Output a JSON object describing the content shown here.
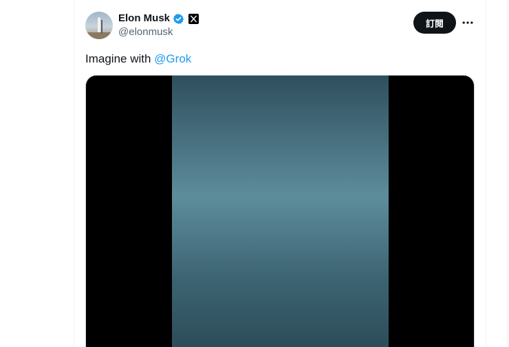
{
  "tweet": {
    "author": {
      "display_name": "Elon Musk",
      "handle": "@elonmusk",
      "verified": true,
      "avatar_icon": "rocket-launch-avatar"
    },
    "subscribe_label": "訂閱",
    "more_icon": "ellipsis-icon",
    "text": {
      "prefix": "Imagine with ",
      "mention": "@Grok"
    },
    "media": {
      "type": "image",
      "alt": "AI-generated image"
    }
  },
  "colors": {
    "link": "#1d9bf0",
    "verified": "#1d9bf0",
    "button_bg": "#0f1419",
    "secondary_text": "#536471",
    "border": "#eff3f4"
  }
}
